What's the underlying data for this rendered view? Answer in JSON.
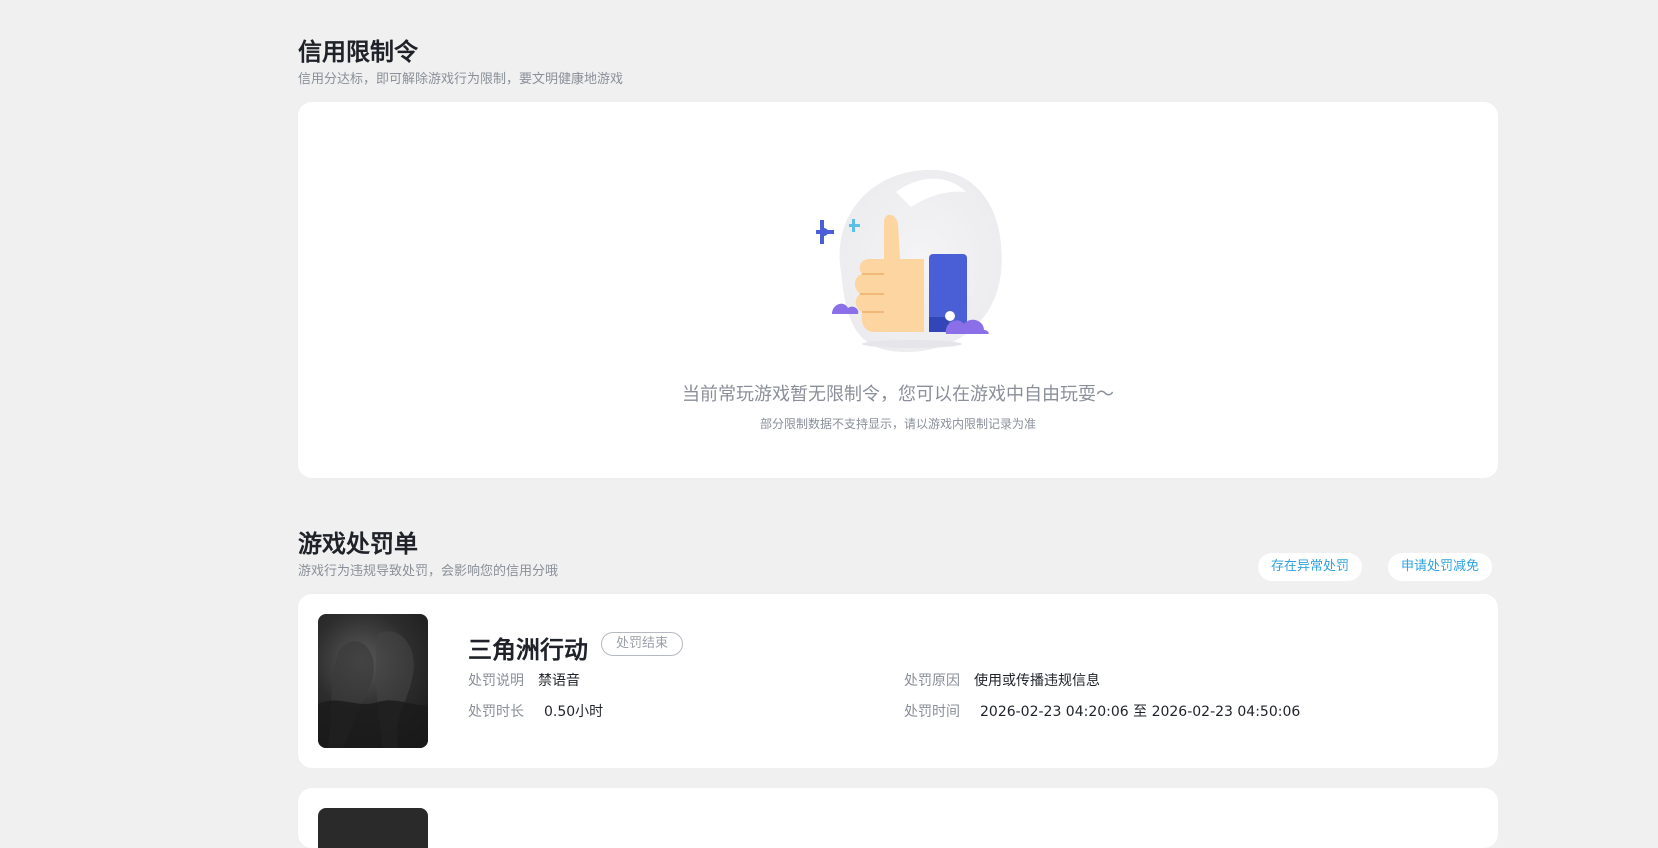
{
  "credit": {
    "title": "信用限制令",
    "subtitle": "信用分达标，即可解除游戏行为限制，要文明健康地游戏",
    "empty_main": "当前常玩游戏暂无限制令，您可以在游戏中自由玩耍～",
    "empty_tip": "部分限制数据不支持显示，请以游戏内限制记录为准"
  },
  "penalty": {
    "title": "游戏处罚单",
    "subtitle": "游戏行为违规导致处罚，会影响您的信用分哦",
    "abnormal_btn": "存在异常处罚",
    "appeal_btn": "申请处罚减免",
    "item": {
      "game": "三角洲行动",
      "status": "处罚结束",
      "desc_label": "处罚说明",
      "desc_value": "禁语音",
      "reason_label": "处罚原因",
      "reason_value": "使用或传播违规信息",
      "duration_label": "处罚时长",
      "duration_value": "0.50小时",
      "time_label": "处罚时间",
      "time_value": "2026-02-23 04:20:06 至 2026-02-23 04:50:06"
    }
  },
  "colors": {
    "accent": "#2fa3e0",
    "thumb_blue": "#4a5fd6",
    "cloud_purple": "#8a6fe8"
  }
}
